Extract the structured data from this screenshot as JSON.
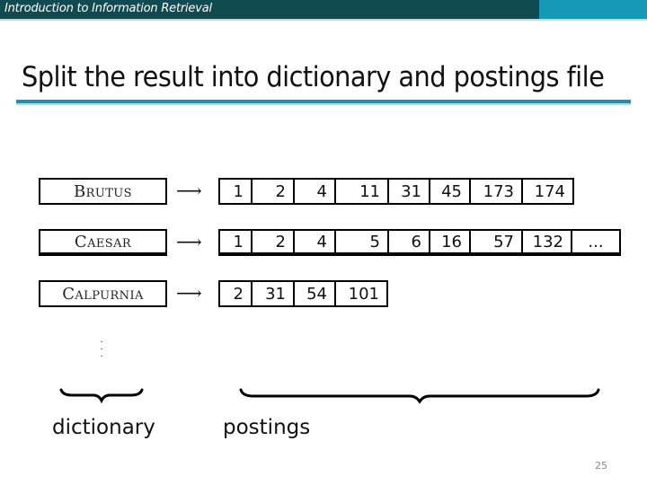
{
  "header": {
    "title": "Introduction to Information Retrieval",
    "colors": {
      "bar": "#124a52",
      "accent": "#1499b5"
    }
  },
  "slide": {
    "title": "Split the result into dictionary and postings file",
    "rule_color": "#2590aa",
    "page_number": "25"
  },
  "diagram": {
    "arrow_glyph": "⟶",
    "ellipsis_vertical": "⋮",
    "rows": [
      {
        "term": "Brutus",
        "postings": [
          "1",
          "2",
          "4",
          "11",
          "31",
          "45",
          "173",
          "174"
        ]
      },
      {
        "term": "Caesar",
        "postings": [
          "1",
          "2",
          "4",
          "5",
          "6",
          "16",
          "57",
          "132",
          "..."
        ]
      },
      {
        "term": "Calpurnia",
        "postings": [
          "2",
          "31",
          "54",
          "101"
        ]
      }
    ],
    "labels": {
      "dictionary": "dictionary",
      "postings": "postings"
    }
  }
}
